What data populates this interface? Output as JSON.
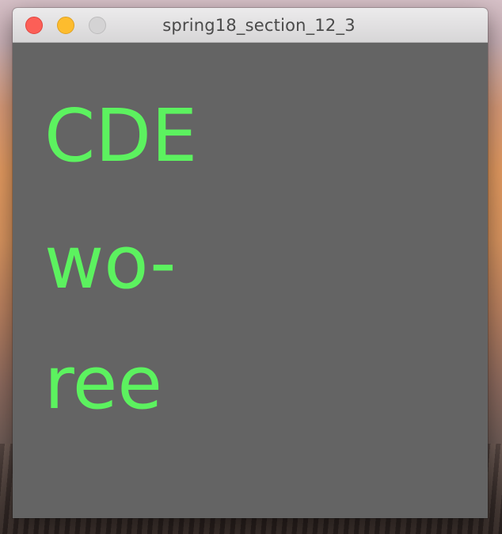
{
  "window": {
    "title": "spring18_section_12_3"
  },
  "canvas": {
    "lines": [
      "CDE",
      "wo-",
      "ree"
    ],
    "text_color": "#5cf25f",
    "background_color": "#646464"
  },
  "traffic_lights": {
    "close_color": "#fc5f57",
    "minimize_color": "#fdbc2e",
    "zoom_color": "#d4d3d4"
  }
}
